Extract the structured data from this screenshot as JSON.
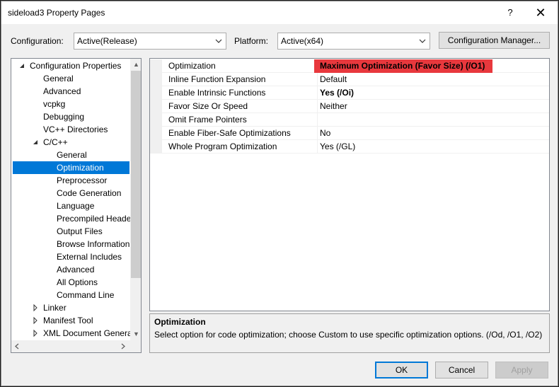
{
  "window": {
    "title": "sideload3 Property Pages",
    "help_glyph": "?",
    "close_glyph": "✕"
  },
  "toolbar": {
    "configuration_label": "Configuration:",
    "configuration_value": "Active(Release)",
    "platform_label": "Platform:",
    "platform_value": "Active(x64)",
    "config_manager_label": "Configuration Manager..."
  },
  "tree": {
    "items": [
      {
        "label": "Configuration Properties",
        "toggle": "expanded"
      },
      {
        "label": "General"
      },
      {
        "label": "Advanced"
      },
      {
        "label": "vcpkg"
      },
      {
        "label": "Debugging"
      },
      {
        "label": "VC++ Directories"
      },
      {
        "label": "C/C++",
        "toggle": "expanded"
      },
      {
        "label": "General"
      },
      {
        "label": "Optimization",
        "selected": true
      },
      {
        "label": "Preprocessor"
      },
      {
        "label": "Code Generation"
      },
      {
        "label": "Language"
      },
      {
        "label": "Precompiled Heade"
      },
      {
        "label": "Output Files"
      },
      {
        "label": "Browse Information"
      },
      {
        "label": "External Includes"
      },
      {
        "label": "Advanced"
      },
      {
        "label": "All Options"
      },
      {
        "label": "Command Line"
      },
      {
        "label": "Linker",
        "toggle": "collapsed"
      },
      {
        "label": "Manifest Tool",
        "toggle": "collapsed"
      },
      {
        "label": "XML Document Genera",
        "toggle": "collapsed"
      }
    ]
  },
  "grid": {
    "rows": [
      {
        "name": "Optimization",
        "value": "Maximum Optimization (Favor Size) (/O1)",
        "bold": true,
        "highlighted": true
      },
      {
        "name": "Inline Function Expansion",
        "value": "Default"
      },
      {
        "name": "Enable Intrinsic Functions",
        "value": "Yes (/Oi)",
        "bold": true
      },
      {
        "name": "Favor Size Or Speed",
        "value": "Neither"
      },
      {
        "name": "Omit Frame Pointers",
        "value": ""
      },
      {
        "name": "Enable Fiber-Safe Optimizations",
        "value": "No"
      },
      {
        "name": "Whole Program Optimization",
        "value": "Yes (/GL)"
      }
    ]
  },
  "description": {
    "title": "Optimization",
    "text": "Select option for code optimization; choose Custom to use specific optimization options.       (/Od, /O1, /O2)"
  },
  "buttons": {
    "ok": "OK",
    "cancel": "Cancel",
    "apply": "Apply"
  },
  "colors": {
    "accent": "#0078d7",
    "highlight": "#e8383d"
  }
}
